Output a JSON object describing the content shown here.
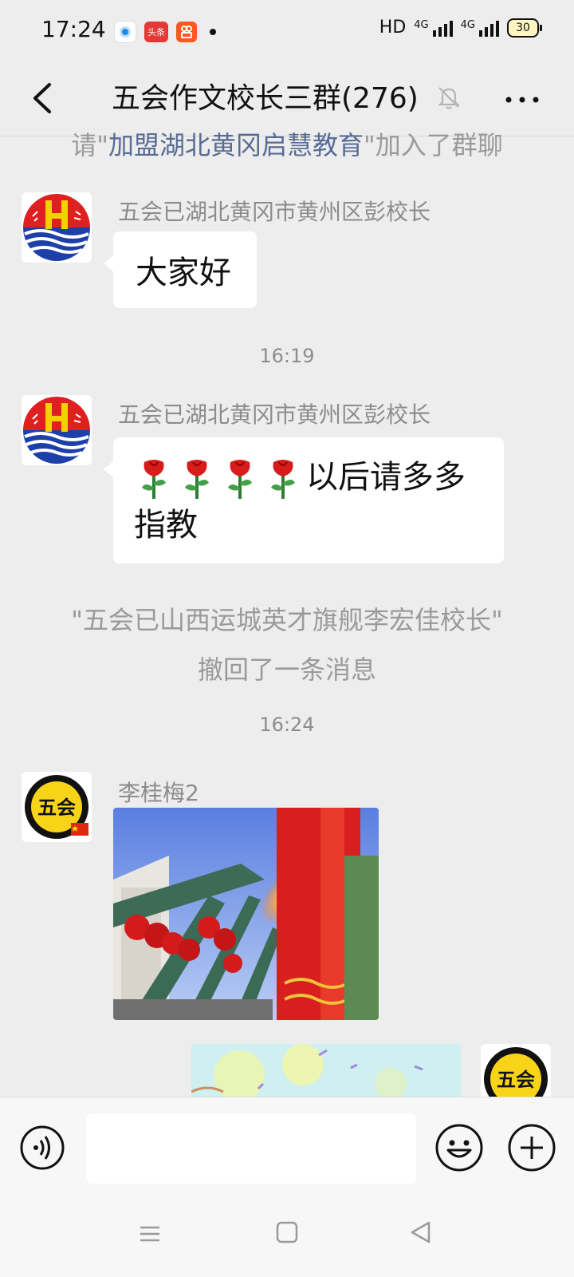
{
  "status_bar": {
    "time": "17:24",
    "app_icons": [
      "browser-app-icon",
      "toutiao-app-icon",
      "kuaishou-app-icon"
    ],
    "toutiao_label": "头条",
    "hd_label": "HD",
    "network_1": "4G",
    "network_2": "4G",
    "battery": "30"
  },
  "header": {
    "title": "五会作文校长三群(276)"
  },
  "messages": {
    "join_notice_prefix": "请\"",
    "join_notice_name": "加盟湖北黄冈启慧教育",
    "join_notice_suffix": "\"加入了群聊",
    "msg1_sender": "五会已湖北黄冈市黄州区彭校长",
    "msg1_text": "大家好",
    "time1": "16:19",
    "msg2_sender": "五会已湖北黄冈市黄州区彭校长",
    "msg2_text": "以后请多多指教",
    "recall_notice": "\"五会已山西运城英才旗舰李宏佳校长\" 撤回了一条消息",
    "time2": "16:24",
    "msg3_sender": "李桂梅2",
    "avatar_logo_text": "五会"
  },
  "colors": {
    "background": "#ededed",
    "link_blue": "#576b95",
    "bubble": "#ffffff"
  }
}
